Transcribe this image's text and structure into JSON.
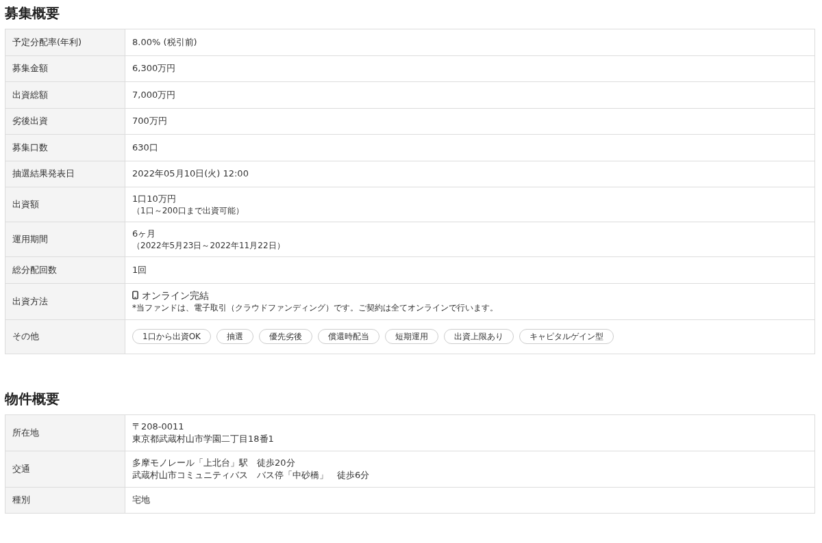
{
  "sections": [
    {
      "title": "募集概要",
      "rows": [
        {
          "kind": "plain",
          "label": "予定分配率(年利)",
          "lines": [
            "8.00% (税引前)"
          ]
        },
        {
          "kind": "plain",
          "label": "募集金額",
          "lines": [
            "6,300万円"
          ]
        },
        {
          "kind": "plain",
          "label": "出資総額",
          "lines": [
            "7,000万円"
          ]
        },
        {
          "kind": "plain",
          "label": "劣後出資",
          "lines": [
            "700万円"
          ]
        },
        {
          "kind": "plain",
          "label": "募集口数",
          "lines": [
            "630口"
          ]
        },
        {
          "kind": "plain",
          "label": "抽選結果発表日",
          "lines": [
            "2022年05月10日(火) 12:00"
          ]
        },
        {
          "kind": "noted",
          "label": "出資額",
          "lines": [
            "1口10万円"
          ],
          "note": "（1口～200口まで出資可能）"
        },
        {
          "kind": "noted",
          "label": "運用期間",
          "lines": [
            "6ヶ月"
          ],
          "note": "（2022年5月23日～2022年11月22日）"
        },
        {
          "kind": "plain",
          "label": "総分配回数",
          "lines": [
            "1回"
          ]
        },
        {
          "kind": "online",
          "label": "出資方法",
          "lines": [
            "オンライン完結"
          ],
          "note": "*当ファンドは、電子取引（クラウドファンディング）です。ご契約は全てオンラインで行います。"
        },
        {
          "kind": "tags",
          "label": "その他",
          "tags": [
            "1口から出資OK",
            "抽選",
            "優先劣後",
            "償還時配当",
            "短期運用",
            "出資上限あり",
            "キャピタルゲイン型"
          ]
        }
      ]
    },
    {
      "title": "物件概要",
      "rows": [
        {
          "kind": "plain",
          "label": "所在地",
          "lines": [
            "〒208-0011",
            "東京都武蔵村山市学園二丁目18番1"
          ]
        },
        {
          "kind": "plain",
          "label": "交通",
          "lines": [
            "多摩モノレール「上北台」駅　徒歩20分",
            "武蔵村山市コミュニティバス　バス停「中砂橋」　徒歩6分"
          ]
        },
        {
          "kind": "plain",
          "label": "種別",
          "lines": [
            "宅地"
          ]
        }
      ]
    }
  ]
}
